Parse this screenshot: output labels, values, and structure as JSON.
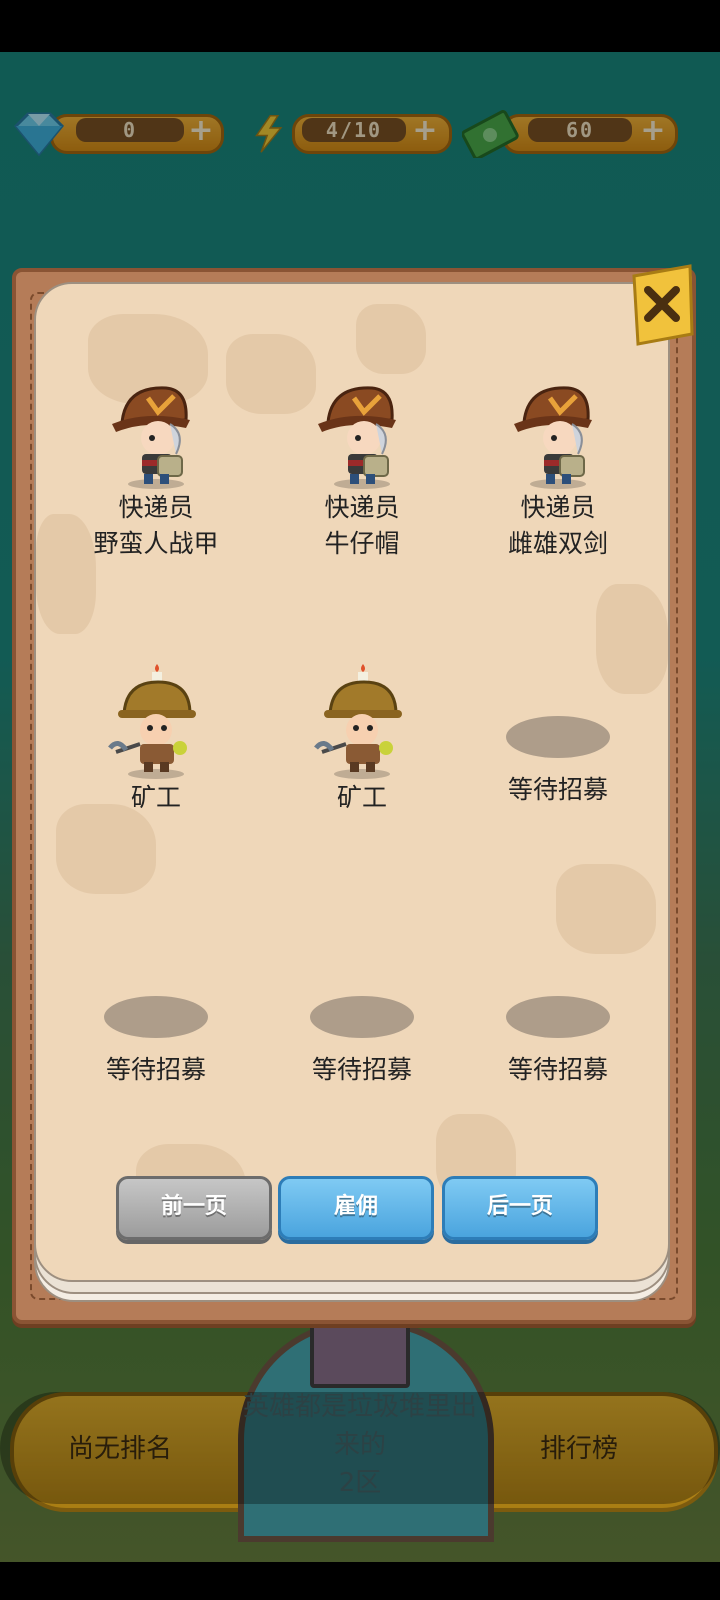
{
  "currency": {
    "gems": "0",
    "energy": "4/10",
    "cash": "60"
  },
  "heroes": [
    {
      "line1": "快递员",
      "line2": "野蛮人战甲",
      "figure": "courier-icon"
    },
    {
      "line1": "快递员",
      "line2": "牛仔帽",
      "figure": "courier-icon"
    },
    {
      "line1": "快递员",
      "line2": "雌雄双剑",
      "figure": "courier-icon"
    },
    {
      "line1": "矿工",
      "line2": "",
      "figure": "miner-icon"
    },
    {
      "line1": "矿工",
      "line2": "",
      "figure": "miner-icon"
    },
    {
      "line1": "等待招募",
      "line2": "",
      "figure": "empty-slot"
    },
    {
      "line1": "等待招募",
      "line2": "",
      "figure": "empty-slot"
    },
    {
      "line1": "等待招募",
      "line2": "",
      "figure": "empty-slot"
    },
    {
      "line1": "等待招募",
      "line2": "",
      "figure": "empty-slot"
    }
  ],
  "buttons": {
    "prev": "前一页",
    "hire": "雇佣",
    "next": "后一页"
  },
  "bottom": {
    "rank": "尚无排名",
    "server_line1": "英雄都是垃圾堆里出",
    "server_line2": "来的",
    "server_zone": "2区",
    "leaderboard": "排行榜"
  },
  "colors": {
    "panel_bg": "#efd7b9",
    "frame": "#b57c58",
    "blue_button": "#4aa4de",
    "gray_button": "#9c9c9c",
    "gold": "#e9a42a"
  }
}
